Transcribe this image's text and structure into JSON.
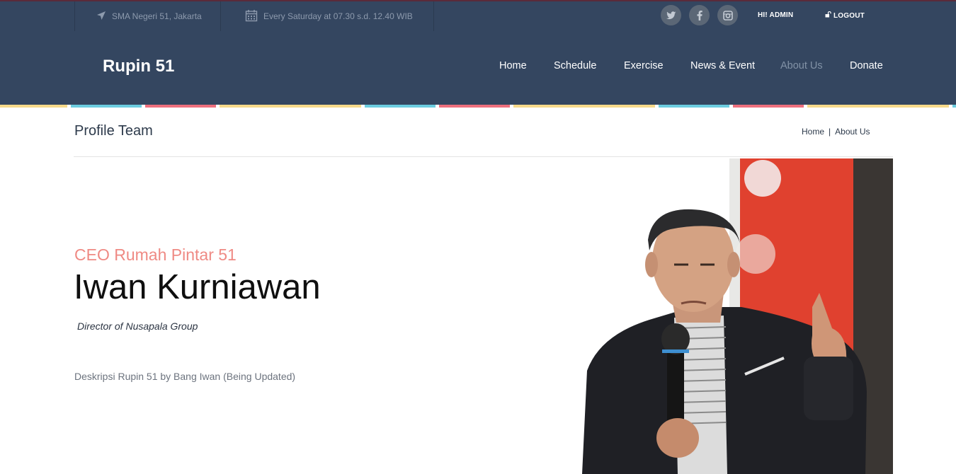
{
  "topbar": {
    "location": "SMA Negeri 51, Jakarta",
    "schedule": "Every Saturday at 07.30 s.d. 12.40 WIB",
    "social": [
      {
        "icon": "twitter-icon",
        "glyph": "t"
      },
      {
        "icon": "facebook-icon",
        "glyph": "f"
      },
      {
        "icon": "instagram-icon",
        "glyph": "◎"
      }
    ],
    "user_label": "HI! ADMIN",
    "logout_label": "LOGOUT"
  },
  "header": {
    "brand": "Rupin 51",
    "nav": [
      {
        "label": "Home",
        "active": false
      },
      {
        "label": "Schedule",
        "active": false
      },
      {
        "label": "Exercise",
        "active": false
      },
      {
        "label": "News & Event",
        "active": false
      },
      {
        "label": "About Us",
        "active": true
      },
      {
        "label": "Donate",
        "active": false
      }
    ]
  },
  "page": {
    "title": "Profile Team",
    "breadcrumb": [
      "Home",
      "About Us"
    ],
    "breadcrumb_separator": "|"
  },
  "profile": {
    "role": "CEO Rumah Pintar 51",
    "name": "Iwan Kurniawan",
    "subtitle": "Director of Nusapala Group",
    "description": "Deskripsi Rupin 51 by Bang Iwan (Being Updated)"
  },
  "colors": {
    "header_bg": "#344660",
    "accent_role": "#ef8a84",
    "strip": [
      "#f6d98a",
      "#6ccde0",
      "#ee6f7e"
    ]
  }
}
